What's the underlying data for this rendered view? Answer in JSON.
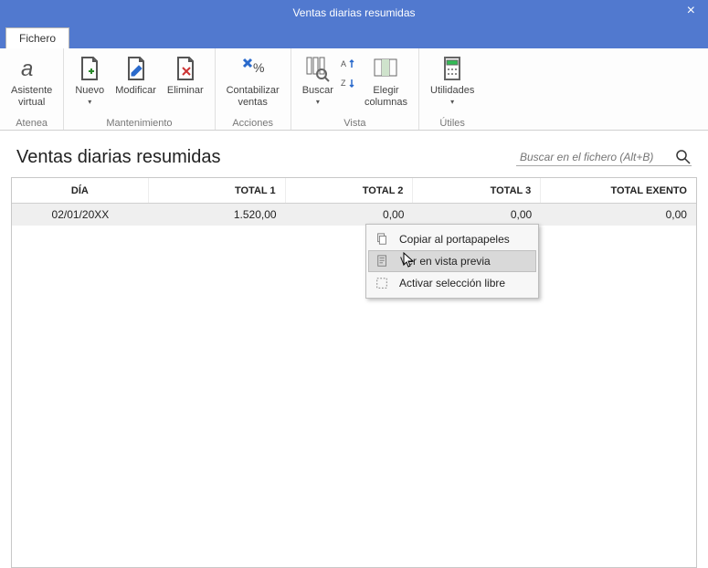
{
  "window": {
    "title": "Ventas diarias resumidas"
  },
  "tabs": {
    "fichero": "Fichero"
  },
  "ribbon": {
    "asistente": {
      "label": "Asistente\nvirtual",
      "group": "Atenea"
    },
    "nuevo": "Nuevo",
    "modificar": "Modificar",
    "eliminar": "Eliminar",
    "mantenimiento_group": "Mantenimiento",
    "contabilizar": "Contabilizar\nventas",
    "acciones_group": "Acciones",
    "buscar": "Buscar",
    "elegir": "Elegir\ncolumnas",
    "vista_group": "Vista",
    "utilidades": "Utilidades",
    "utiles_group": "Útiles"
  },
  "content": {
    "title": "Ventas diarias resumidas",
    "search_placeholder": "Buscar en el fichero (Alt+B)"
  },
  "grid": {
    "headers": {
      "dia": "DÍA",
      "t1": "TOTAL 1",
      "t2": "TOTAL 2",
      "t3": "TOTAL 3",
      "te": "TOTAL EXENTO"
    },
    "rows": [
      {
        "dia": "02/01/20XX",
        "t1": "1.520,00",
        "t2": "0,00",
        "t3": "0,00",
        "te": "0,00"
      }
    ]
  },
  "context_menu": {
    "copiar": "Copiar al portapapeles",
    "vista_previa": "Ver en vista previa",
    "seleccion_libre": "Activar selección libre"
  }
}
